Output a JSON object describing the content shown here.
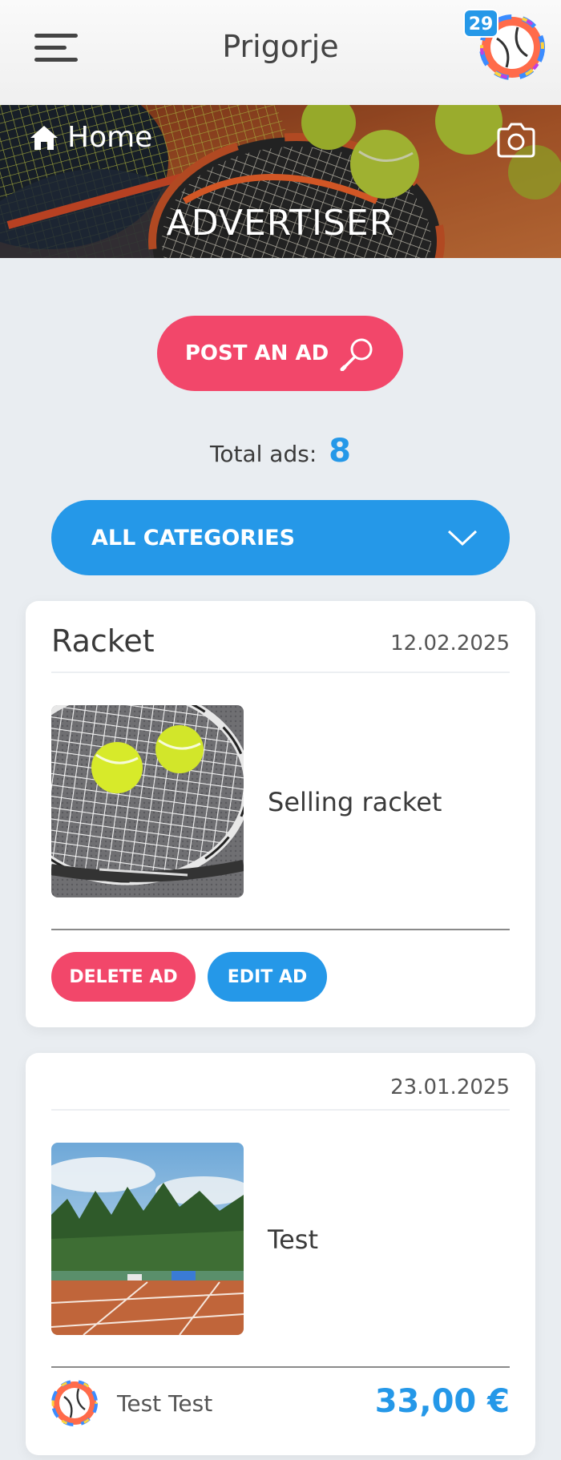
{
  "header": {
    "title": "Prigorje",
    "notification_count": "29",
    "menu_icon": "hamburger-icon",
    "avatar_icon": "tennis-ball-avatar"
  },
  "banner": {
    "home_label": "Home",
    "title": "ADVERTISER",
    "home_icon": "home-icon",
    "camera_icon": "camera-icon"
  },
  "actions": {
    "post_ad_label": "POST AN AD",
    "post_ad_icon": "racket-icon",
    "total_ads_label": "Total ads:",
    "total_ads_count": "8",
    "category_label": "ALL CATEGORIES",
    "category_icon": "chevron-down-icon"
  },
  "ads": [
    {
      "title": "Racket",
      "date": "12.02.2025",
      "description": "Selling racket",
      "delete_label": "DELETE AD",
      "edit_label": "EDIT AD"
    },
    {
      "title": "",
      "date": "23.01.2025",
      "description": "Test",
      "seller": "Test Test",
      "price": "33,00 €"
    }
  ],
  "colors": {
    "accent_pink": "#f2476a",
    "accent_blue": "#2598e8",
    "background": "#e9edf1"
  }
}
